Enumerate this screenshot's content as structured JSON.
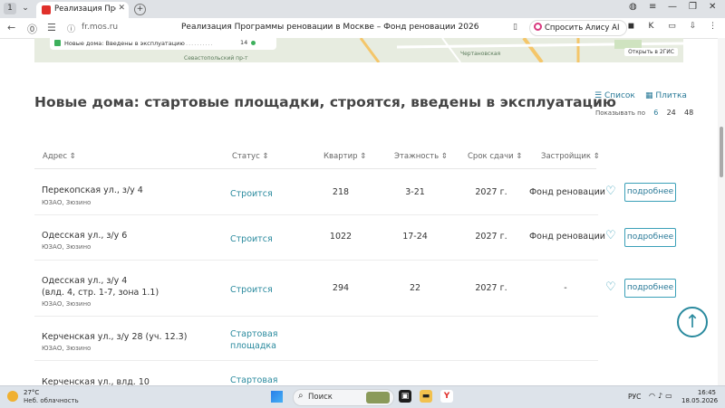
{
  "browser": {
    "tab_title": "Реализация Программ",
    "url": "fr.mos.ru",
    "page_title": "Реализация Программы реновации в Москве – Фонд реновации 2026",
    "alice_label": "Спросить Алису AI"
  },
  "map": {
    "legend_label": "Новые дома: Введены в эксплуатацию",
    "legend_count": "14",
    "streets": [
      "Севастопольский пр-т",
      "Чертановская"
    ],
    "open_2gis": "Открыть в 2ГИС"
  },
  "page": {
    "heading": "Новые дома: стартовые площадки, строятся, введены в эксплуатацию",
    "view_list": "Список",
    "view_tiles": "Плитка",
    "show_by_label": "Показывать по",
    "show_by_options": [
      "6",
      "24",
      "48"
    ]
  },
  "table": {
    "headers": {
      "address": "Адрес",
      "status": "Статус",
      "apartments": "Квартир",
      "floors": "Этажность",
      "deadline": "Срок сдачи",
      "developer": "Застройщик"
    },
    "more_label": "подробнее",
    "rows": [
      {
        "address_line1": "Перекопская ул., з/у 4",
        "address_line2": "",
        "district": "ЮЗАО, Зюзино",
        "status_line1": "Строится",
        "status_line2": "",
        "apartments": "218",
        "floors": "3-21",
        "deadline": "2027 г.",
        "developer": "Фонд реновации"
      },
      {
        "address_line1": "Одесская ул., з/у 6",
        "address_line2": "",
        "district": "ЮЗАО, Зюзино",
        "status_line1": "Строится",
        "status_line2": "",
        "apartments": "1022",
        "floors": "17-24",
        "deadline": "2027 г.",
        "developer": "Фонд реновации"
      },
      {
        "address_line1": "Одесская ул., з/у 4",
        "address_line2": "(влд. 4, стр. 1-7, зона 1.1)",
        "district": "ЮЗАО, Зюзино",
        "status_line1": "Строится",
        "status_line2": "",
        "apartments": "294",
        "floors": "22",
        "deadline": "2027 г.",
        "developer": "-"
      },
      {
        "address_line1": "Керченская ул., з/у 28 (уч. 12.3)",
        "address_line2": "",
        "district": "ЮЗАО, Зюзино",
        "status_line1": "Стартовая",
        "status_line2": "площадка",
        "apartments": "",
        "floors": "",
        "deadline": "",
        "developer": ""
      },
      {
        "address_line1": "Керченская ул., влд. 10",
        "address_line2": "",
        "district": "",
        "status_line1": "Стартовая",
        "status_line2": "",
        "apartments": "",
        "floors": "",
        "deadline": "",
        "developer": ""
      }
    ]
  },
  "taskbar": {
    "temperature": "27°C",
    "weather": "Неб. облачность",
    "search_placeholder": "Поиск",
    "language": "РУС",
    "time": "16:45",
    "date": "18.05.2026"
  },
  "colors": {
    "accent": "#2a8a9e",
    "heading": "#444444",
    "map_bg": "#e9ede2"
  }
}
